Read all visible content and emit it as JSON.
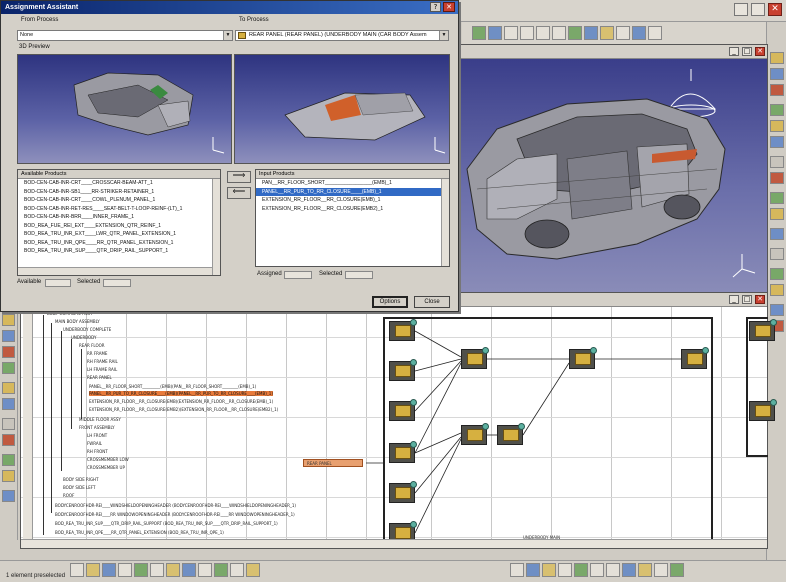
{
  "dialog": {
    "title": "Assignment Assistant",
    "from_process_label": "From Process",
    "from_process_value": "None",
    "to_process_label": "To Process",
    "to_process_value": "REAR PANEL (REAR PANEL) (UNDERBODY MAIN (CAR BODY Assem",
    "preview_label": "3D Preview",
    "available_products_header": "Available Products",
    "available_products": [
      "BOD-CEN-CAB-INR-CRT____CROSSCAR-BEAM-ATT_1",
      "BOD-CEN-CAB-INR-SB1____RR-STRIKER-RETAINER_1",
      "BOD-CEN-CAB-INR-CRT____COWL_PLENUM_PANEL_1",
      "BOD-CEN-CAB-INR-RET-RES____SEAT-BELT-T-LOOP-REINF-(LT)_1",
      "BOD-CEN-CAB-INR-BRR____INNER_FRAME_1",
      "BOD_REA_FUE_REI_EXT____EXTENSION_QTR_REINF_1",
      "BOD_REA_TRU_INR_EXT____LWR_QTR_PANEL_EXTENSION_1",
      "BOD_REA_TRU_INR_QPE____RR_QTR_PANEL_EXTENSION_1",
      "BOD_REA_TRU_INR_SUP____QTR_DRIP_RAIL_SUPPORT_1"
    ],
    "input_products_header": "Input Products",
    "input_products": [
      "PAN__RR_FLOOR_SHORT_________________(EMB)_1",
      "PANEL__RR_PUR_TO_RR_CLOSURE____(EMB)_1",
      "EXTENSION_RR_FLOOR__RR_CLOSURE(EMB)_1",
      "EXTENSION_RR_FLOOR__RR_CLOSURE(EMB2)_1"
    ],
    "selected_input_index": 1,
    "available_label": "Available",
    "selected_label_left": "Selected",
    "assigned_label": "Assigned",
    "selected_label_right": "Selected",
    "add_arrow": "⟹",
    "remove_arrow": "⟸",
    "options_button": "Options",
    "close_button": "Close",
    "help_glyph": "?",
    "close_glyph": "✕"
  },
  "tree": {
    "lines": [
      "BODY COMPLETE ASSY",
      "MAIN BODY ASSEMBLY",
      "UNDERBODY COMPLETE",
      "UNDERBODY",
      "REAR FLOOR",
      "RR FRAME",
      "RH FRAME RAIL",
      "LH FRAME RAIL",
      "REAR PANEL",
      "PANEL__RR_FLOOR_SHORT_________(EMB)(PAN__RR_FLOOR_SHORT________(EMB)_1)",
      "PANEL__RR_PUR_TO_RR_CLOSURE____(EMB)(PANEL__RR_PUR_TO_RR_CLOSURE____(EMB)_1)",
      "EXTENSION_RR_FLOOR__RR_CLOSURE(EMB)(EXTENSION_RR_FLOOR__RR_CLOSURE(EMB)_1)",
      "EXTENSION_RR_FLOOR__RR_CLOSURE(EMB2)(EXTENSION_RR_FLOOR__RR_CLOSURE(EMB2)_1)",
      "MIDDLE FLOOR ASSY",
      "FRONT ASSEMBLY",
      "LH FRONT",
      "FWRAIL",
      "RH FRONT",
      "CROSSMEMBER LOW",
      "CROSSMEMBER UP",
      "BODY SIDE RIGHT",
      "BODY SIDE LEFT",
      "ROOF",
      "BODYCENROOFHDR-REI____WINDSHIELDOPENINGHEADER (BODYCENROOFHDR-REI____WINDSHIELDOPENINGHEADER_1)",
      "BODYCENROOFHDR-REI____RR WINDOWOPENINGHEADER (BODYCENROOFHDR-REI____RR WINDOWOPENINGHEADER_1)",
      "BOD_REA_TRU_INR_SUP____QTR_DRIP_RAIL_SUPPORT (BOD_REA_TRU_INR_SUP____QTR_DRIP_RAIL_SUPPORT_1)",
      "BOD_REA_TRU_INR_QPE____RR_QTR_PANEL_EXTENSION (BOD_REA_TRU_INR_QPE_1)"
    ],
    "highlighted_index": 10
  },
  "graph": {
    "label_underbody_main": "UNDERBODY MAIN",
    "label_small": "REAR PANEL"
  },
  "status": {
    "text": "1 element preselected"
  },
  "window_buttons": {
    "min": "_",
    "max": "□",
    "close": "✕"
  },
  "colors": {
    "title_bar": "#0a246a",
    "highlight": "#e87a3a",
    "selection": "#316ac5",
    "process_box": "#50504a",
    "process_icon": "#d6b040"
  }
}
